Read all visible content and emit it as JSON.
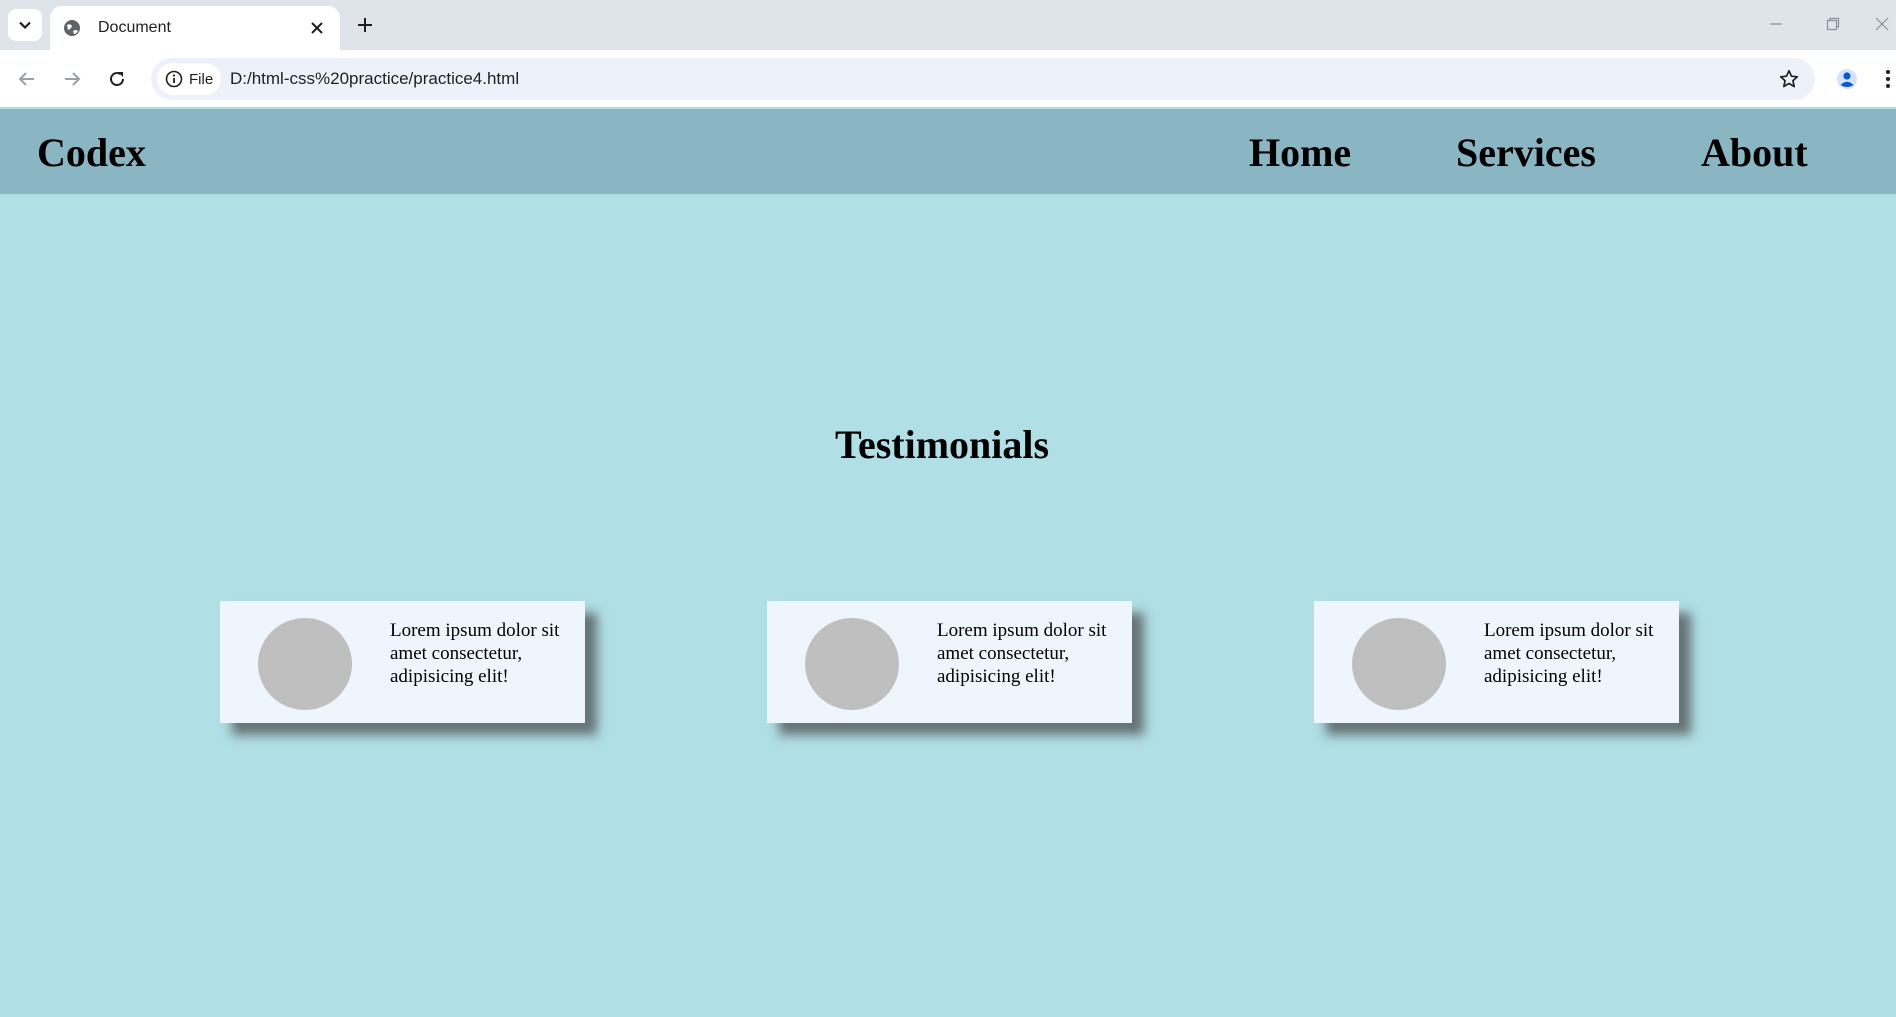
{
  "browser": {
    "tab_title": "Document",
    "address_chip": "File",
    "url": "D:/html-css%20practice/practice4.html",
    "icons": [
      "tab-list-icon",
      "globe-icon",
      "close-icon",
      "plus-icon",
      "minimize-icon",
      "restore-icon",
      "window-close-icon",
      "back-arrow-icon",
      "forward-arrow-icon",
      "reload-icon",
      "info-icon",
      "star-icon",
      "profile-icon",
      "more-vert-icon"
    ]
  },
  "navbar": {
    "logo": "Codex",
    "links": [
      "Home",
      "Services",
      "About"
    ],
    "background": "#8ab5c3"
  },
  "main": {
    "heading": "Testimonials",
    "background": "#b0dfe5"
  },
  "testimonials": [
    {
      "text": "Lorem ipsum dolor sit amet consectetur, adipisicing elit!"
    },
    {
      "text": "Lorem ipsum dolor sit amet consectetur, adipisicing elit!"
    },
    {
      "text": "Lorem ipsum dolor sit amet consectetur, adipisicing elit!"
    }
  ]
}
